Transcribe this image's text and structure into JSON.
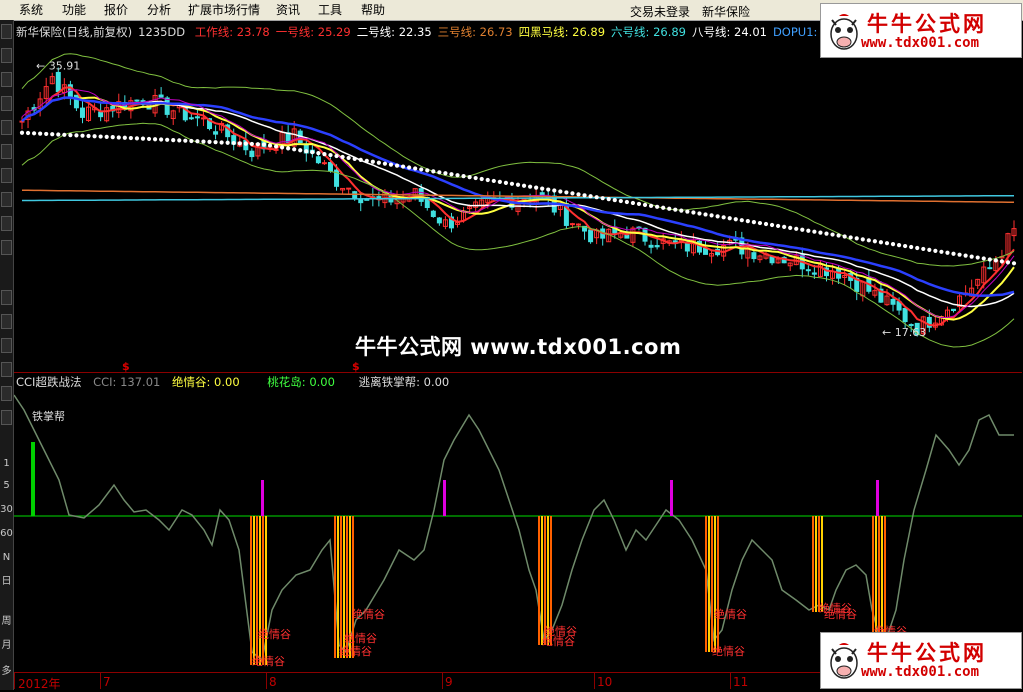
{
  "menu": {
    "items": [
      "系统",
      "功能",
      "报价",
      "分析",
      "扩展市场行情",
      "资讯",
      "工具",
      "帮助"
    ],
    "status": "交易未登录",
    "stock_name": "新华保险"
  },
  "toolbar": {
    "side_labels": [
      "1",
      "5",
      "30",
      "60",
      "N",
      "日",
      "周",
      "月",
      "多"
    ]
  },
  "price_chart": {
    "title": "新华保险(日线,前复权)",
    "code": "1235DD",
    "lines": [
      {
        "label": "工作线:",
        "value": "23.78",
        "color": "#ff3030"
      },
      {
        "label": "一号线:",
        "value": "25.29",
        "color": "#ff3030"
      },
      {
        "label": "二号线:",
        "value": "22.35",
        "color": "#ffffff"
      },
      {
        "label": "三号线:",
        "value": "26.73",
        "color": "#e08030"
      },
      {
        "label": "四黑马线:",
        "value": "26.89",
        "color": "#ffff40"
      },
      {
        "label": "六号线:",
        "value": "26.89",
        "color": "#40e0e0"
      },
      {
        "label": "八号线:",
        "value": "24.01",
        "color": "#ffffff"
      },
      {
        "label": "DOPU1:",
        "value": "26.",
        "color": "#40a0ff"
      }
    ],
    "high_label": "35.91",
    "low_label": "17.63"
  },
  "indicator": {
    "title": "CCI超跌战法",
    "cci_label": "CCI: 137.01",
    "juexugu_label": "绝情谷: 0.00",
    "taohuadao_label": "桃花岛: 0.00",
    "taoli_label": "逃离铁掌帮: 0.00",
    "tiezhangbang_text": "铁掌帮",
    "juexugu_text": "绝情谷"
  },
  "watermark": {
    "center_text": "牛牛公式网 www.tdx001.com",
    "logo_title": "牛牛公式网",
    "logo_url": "www.tdx001.com"
  },
  "axis": {
    "labels": [
      "2012年",
      "7",
      "8",
      "9",
      "10",
      "11"
    ]
  },
  "colors": {
    "background": "#000000",
    "up": "#ff3030",
    "down": "#40e0e0",
    "cci_line": "#6f8a6a",
    "signal_orange": "#ff8c00",
    "signal_magenta": "#e000e0",
    "signal_green": "#00d000",
    "baseline": "#00b000"
  }
}
